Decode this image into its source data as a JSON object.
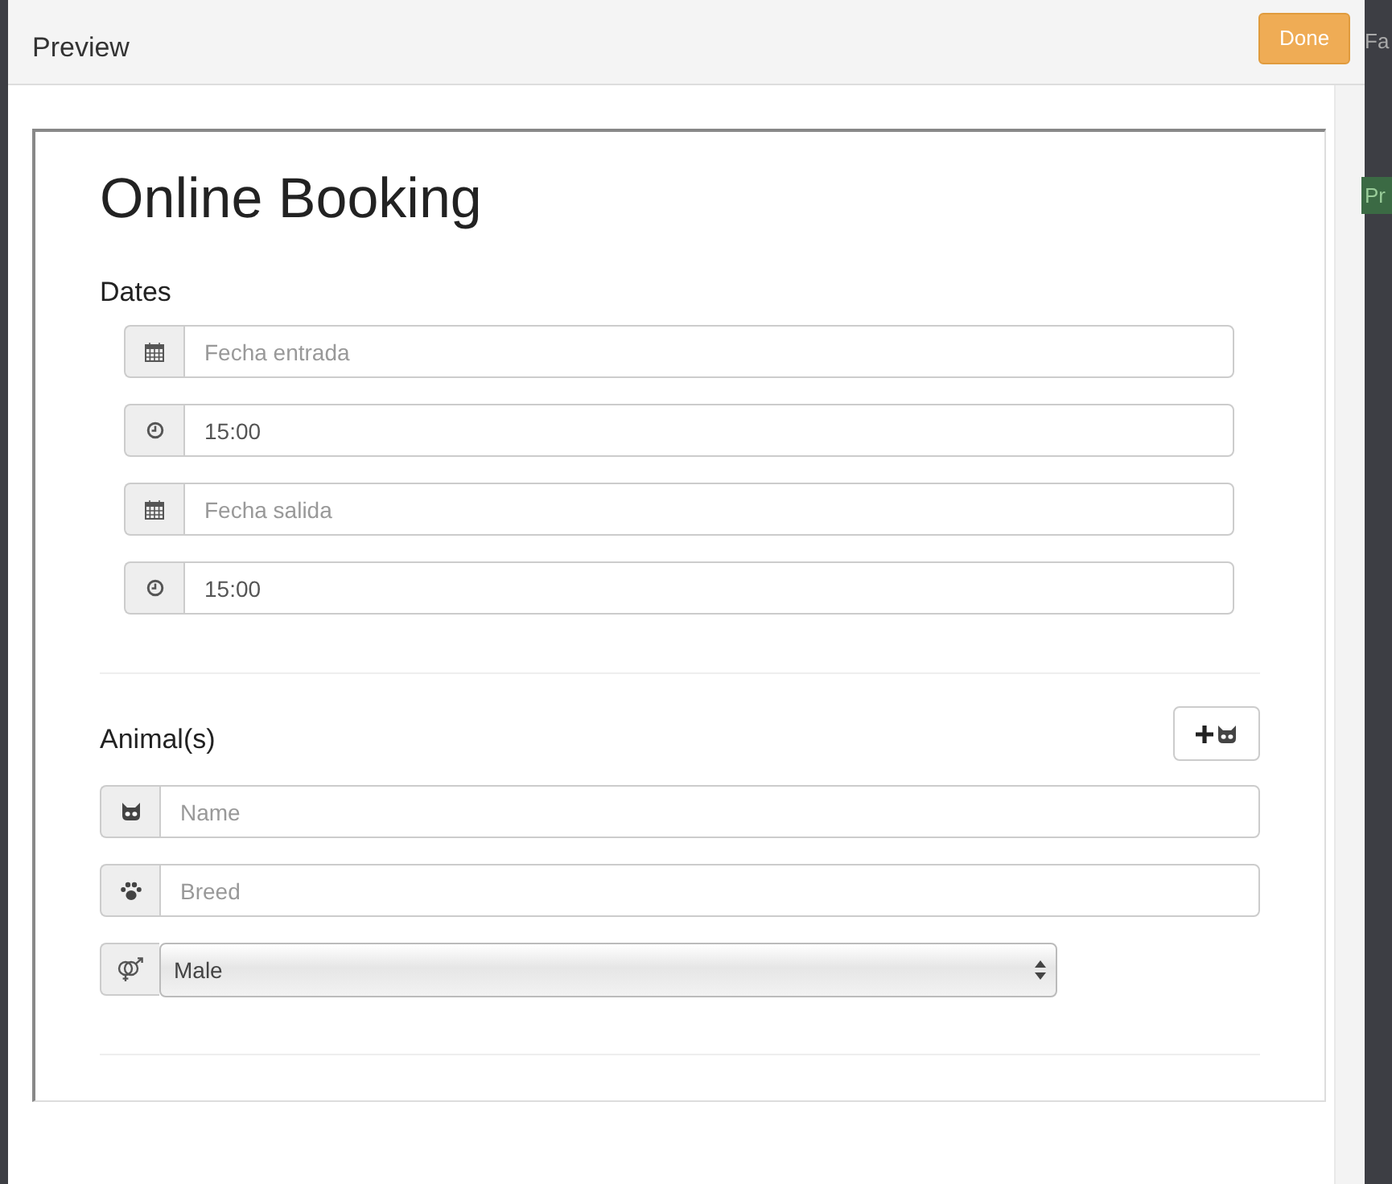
{
  "backdrop": {
    "fragments": [
      "Fa",
      "Pr"
    ]
  },
  "modal": {
    "title": "Preview",
    "done_button": "Done"
  },
  "form": {
    "title": "Online Booking",
    "dates": {
      "heading": "Dates",
      "fields": [
        {
          "kind": "input",
          "placeholder": "Fecha entrada"
        },
        {
          "kind": "input",
          "value": "15:00"
        },
        {
          "kind": "input",
          "placeholder": "Fecha salida"
        },
        {
          "kind": "input",
          "value": "15:00"
        }
      ]
    },
    "animals": {
      "heading": "Animal(s)",
      "fields": [
        {
          "kind": "input",
          "placeholder": "Name"
        },
        {
          "kind": "input",
          "placeholder": "Breed"
        },
        {
          "kind": "select",
          "value": "Male"
        }
      ]
    }
  }
}
